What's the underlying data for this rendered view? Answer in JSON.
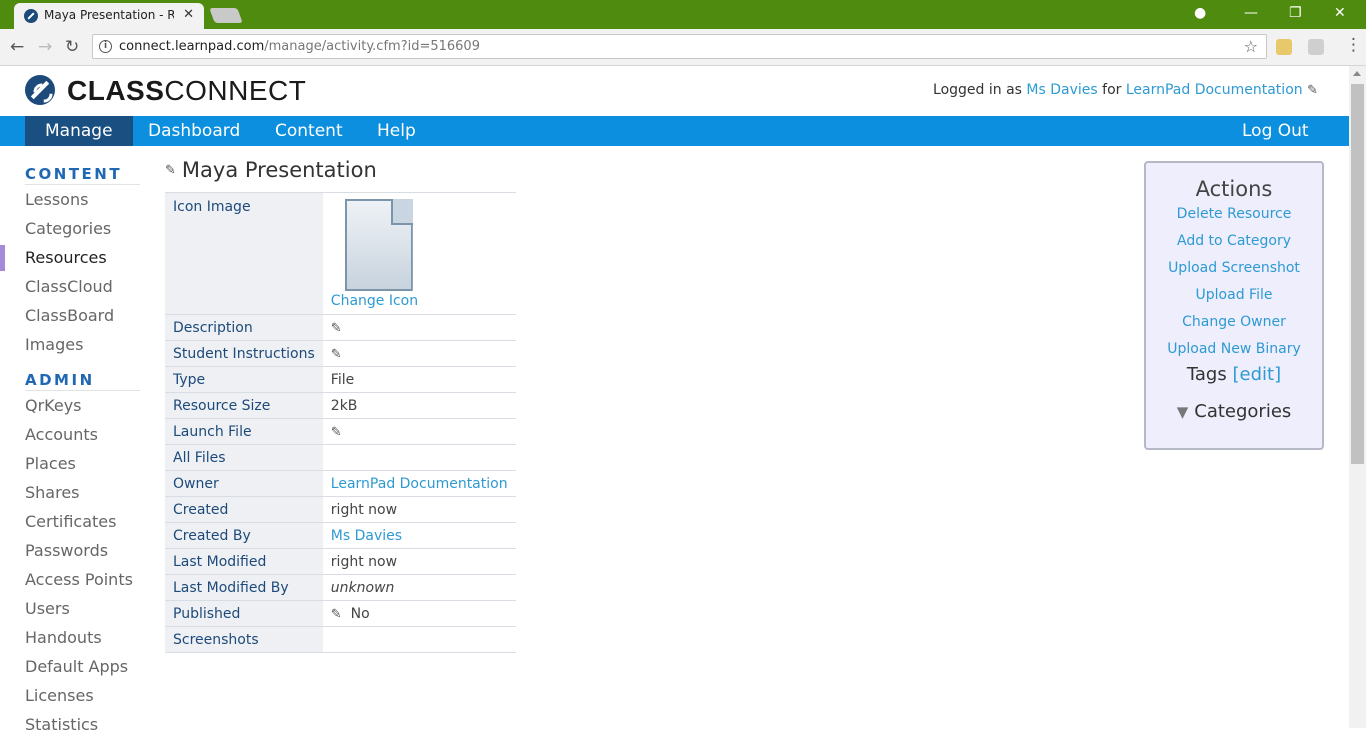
{
  "browser": {
    "tab_title": "Maya Presentation - Reso",
    "url_host": "connect.learnpad.com",
    "url_path": "/manage/activity.cfm?id=516609"
  },
  "header": {
    "logo_bold": "CLASS",
    "logo_light": "CONNECT",
    "logged_in_prefix": "Logged in as",
    "user": "Ms Davies",
    "for_label": "for",
    "org": "LearnPad Documentation"
  },
  "menu": {
    "manage": "Manage",
    "dashboard": "Dashboard",
    "content": "Content",
    "help": "Help",
    "logout": "Log Out"
  },
  "sidebar": {
    "content_heading": "CONTENT",
    "content_items": [
      "Lessons",
      "Categories",
      "Resources",
      "ClassCloud",
      "ClassBoard",
      "Images"
    ],
    "admin_heading": "ADMIN",
    "admin_items": [
      "QrKeys",
      "Accounts",
      "Places",
      "Shares",
      "Certificates",
      "Passwords",
      "Access Points",
      "Users",
      "Handouts",
      "Default Apps",
      "Licenses",
      "Statistics"
    ],
    "active_item": "Resources"
  },
  "main": {
    "title": "Maya Presentation",
    "properties": {
      "icon_image": "Icon Image",
      "change_icon": "Change Icon",
      "description": "Description",
      "student_instructions": "Student Instructions",
      "type_label": "Type",
      "type_value": "File",
      "resource_size_label": "Resource Size",
      "resource_size_value": "2kB",
      "launch_file": "Launch File",
      "all_files": "All Files",
      "owner_label": "Owner",
      "owner_value": "LearnPad Documentation",
      "created_label": "Created",
      "created_value": "right now",
      "created_by_label": "Created By",
      "created_by_value": "Ms Davies",
      "last_modified_label": "Last Modified",
      "last_modified_value": "right now",
      "last_modified_by_label": "Last Modified By",
      "last_modified_by_value": "unknown",
      "published_label": "Published",
      "published_value": "No",
      "screenshots": "Screenshots"
    }
  },
  "actions": {
    "heading": "Actions",
    "links": [
      "Delete Resource",
      "Add to Category",
      "Upload Screenshot",
      "Upload File",
      "Change Owner",
      "Upload New Binary"
    ],
    "tags_label": "Tags",
    "tags_edit": "[edit]",
    "categories": "Categories"
  },
  "colors": {
    "menubar": "#0b8fde",
    "menubar_active": "#1a4f81",
    "link": "#2e9ad3",
    "browser_frame": "#4e8b0f"
  },
  "icons": [
    "info-icon",
    "star-icon",
    "pencil-icon",
    "document-icon",
    "triangle-down-icon"
  ]
}
